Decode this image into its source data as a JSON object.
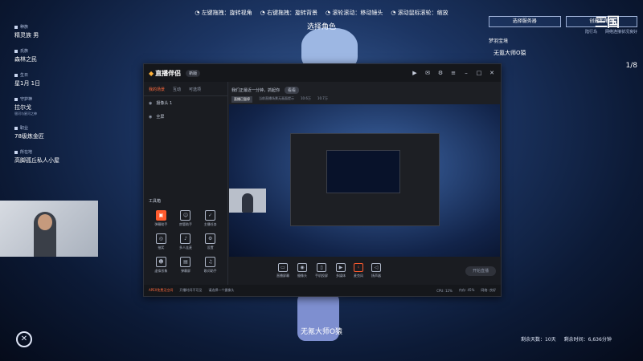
{
  "hints": [
    "左键拖拽：旋转视角",
    "右键拖拽：旋转背景",
    "滚轮滚动：移动镜头",
    "滚动鼠标滚轮：缩放"
  ],
  "character": {
    "top_label": "选择角色",
    "bottom_label": "无氪大师O猿"
  },
  "info": [
    {
      "k": "种族",
      "v": "精灵族 男"
    },
    {
      "k": "氏族",
      "v": "森林之民"
    },
    {
      "k": "生日",
      "v": "星1月 1日"
    },
    {
      "k": "守护神",
      "v": "拉尔戈",
      "sub": "银河与星河之神"
    },
    {
      "k": "职业",
      "v": "78级炼金匠"
    },
    {
      "k": "所在地",
      "v": "高脚孤丘私人小屋"
    }
  ],
  "right_panel": {
    "btn1": "选择服务器",
    "btn2": "创建新角色",
    "sub1": "陆行鸟",
    "sub2": "网络连接状况良好",
    "tag": "梦羽宝境",
    "name": "无氪大师O猿",
    "pager": "1/8"
  },
  "game_logo": "三国",
  "bottom_stats": {
    "days": "剩余天数：10天",
    "minutes": "剩余时间：6,636分钟"
  },
  "app": {
    "title": "直播伴侣",
    "version": "新版",
    "tabs": [
      "我的场景",
      "互动",
      "可选项"
    ],
    "scenes": [
      "摄像头 1",
      "全屏"
    ],
    "tools_title": "工具箱",
    "tools": [
      "弹幕助手",
      "房管助手",
      "主播任务",
      "抽奖",
      "多人连麦",
      "设置",
      "虚拟形象",
      "弹幕屏",
      "歌词助手"
    ],
    "notice": "我们正最近一分钟，抓起你",
    "notice_tag": "看看",
    "stats": [
      "直播已暂停",
      "当前直播场景无画面提示",
      "10.6万",
      "10.7万"
    ],
    "bar": [
      "直播屏幕",
      "摄像头",
      "手机投屏",
      "多媒体",
      "麦克风",
      "扬声器"
    ],
    "live_btn": "开始直播",
    "status": [
      "APEX免费无空间",
      "开播时间不可见",
      "请选择一个摄像头",
      "CPU: 12%",
      "内存: 45%",
      "网络: 良好"
    ]
  }
}
